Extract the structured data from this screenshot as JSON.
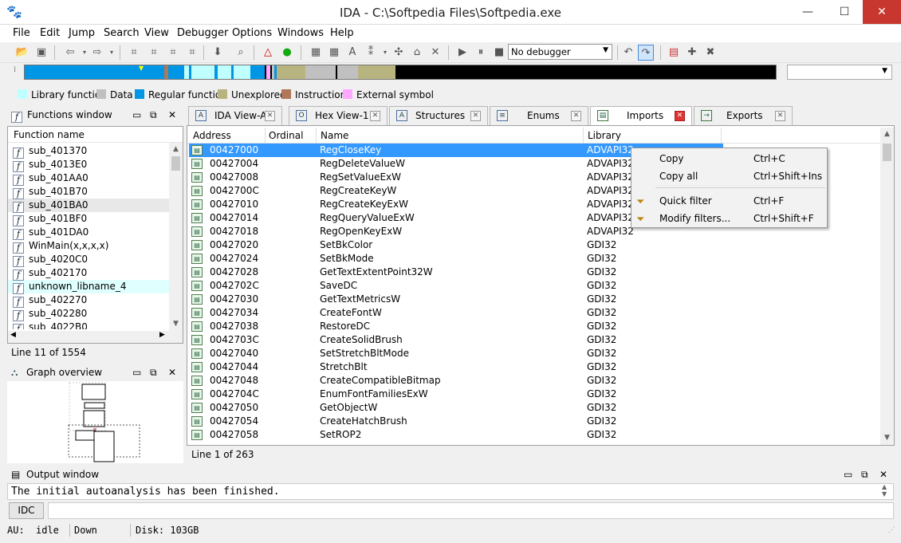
{
  "window": {
    "title": "IDA - C:\\Softpedia Files\\Softpedia.exe"
  },
  "menu": [
    "File",
    "Edit",
    "Jump",
    "Search",
    "View",
    "Debugger",
    "Options",
    "Windows",
    "Help"
  ],
  "toolbar": {
    "debugger_select": "No debugger"
  },
  "legend": [
    {
      "label": "Library function",
      "color": "#c0ffff"
    },
    {
      "label": "Data",
      "color": "#c0c0c0"
    },
    {
      "label": "Regular function",
      "color": "#0096e6"
    },
    {
      "label": "Unexplored",
      "color": "#b8b480"
    },
    {
      "label": "Instruction",
      "color": "#b07858"
    },
    {
      "label": "External symbol",
      "color": "#ffa8ff"
    }
  ],
  "functions_window": {
    "title": "Functions window",
    "column": "Function name",
    "items": [
      "sub_401370",
      "sub_4013E0",
      "sub_401AA0",
      "sub_401B70",
      "sub_401BA0",
      "sub_401BF0",
      "sub_401DA0",
      "WinMain(x,x,x,x)",
      "sub_4020C0",
      "sub_402170",
      "unknown_libname_4",
      "sub_402270",
      "sub_402280",
      "sub_4022B0"
    ],
    "status": "Line 11 of 1554"
  },
  "graph_overview": {
    "title": "Graph overview"
  },
  "tabs": [
    {
      "label": "IDA View-A",
      "icon": "A"
    },
    {
      "label": "Hex View-1",
      "icon": "O"
    },
    {
      "label": "Structures",
      "icon": "A"
    },
    {
      "label": "Enums",
      "icon": "≡"
    },
    {
      "label": "Imports",
      "icon": "▤"
    },
    {
      "label": "Exports",
      "icon": "→"
    }
  ],
  "imports": {
    "columns": [
      "Address",
      "Ordinal",
      "Name",
      "Library"
    ],
    "rows": [
      [
        "00427000",
        "RegCloseKey",
        "ADVAPI32"
      ],
      [
        "00427004",
        "RegDeleteValueW",
        "ADVAPI32"
      ],
      [
        "00427008",
        "RegSetValueExW",
        "ADVAPI32"
      ],
      [
        "0042700C",
        "RegCreateKeyW",
        "ADVAPI32"
      ],
      [
        "00427010",
        "RegCreateKeyExW",
        "ADVAPI32"
      ],
      [
        "00427014",
        "RegQueryValueExW",
        "ADVAPI32"
      ],
      [
        "00427018",
        "RegOpenKeyExW",
        "ADVAPI32"
      ],
      [
        "00427020",
        "SetBkColor",
        "GDI32"
      ],
      [
        "00427024",
        "SetBkMode",
        "GDI32"
      ],
      [
        "00427028",
        "GetTextExtentPoint32W",
        "GDI32"
      ],
      [
        "0042702C",
        "SaveDC",
        "GDI32"
      ],
      [
        "00427030",
        "GetTextMetricsW",
        "GDI32"
      ],
      [
        "00427034",
        "CreateFontW",
        "GDI32"
      ],
      [
        "00427038",
        "RestoreDC",
        "GDI32"
      ],
      [
        "0042703C",
        "CreateSolidBrush",
        "GDI32"
      ],
      [
        "00427040",
        "SetStretchBltMode",
        "GDI32"
      ],
      [
        "00427044",
        "StretchBlt",
        "GDI32"
      ],
      [
        "00427048",
        "CreateCompatibleBitmap",
        "GDI32"
      ],
      [
        "0042704C",
        "EnumFontFamiliesExW",
        "GDI32"
      ],
      [
        "00427050",
        "GetObjectW",
        "GDI32"
      ],
      [
        "00427054",
        "CreateHatchBrush",
        "GDI32"
      ],
      [
        "00427058",
        "SetROP2",
        "GDI32"
      ]
    ],
    "status": "Line 1 of 263"
  },
  "context_menu": [
    {
      "label": "Copy",
      "shortcut": "Ctrl+C"
    },
    {
      "label": "Copy all",
      "shortcut": "Ctrl+Shift+Ins"
    },
    {
      "label": "Quick filter",
      "shortcut": "Ctrl+F"
    },
    {
      "label": "Modify filters...",
      "shortcut": "Ctrl+Shift+F"
    }
  ],
  "output_window": {
    "title": "Output window",
    "text": "The initial autoanalysis has been finished.",
    "idc_button": "IDC"
  },
  "statusbar": {
    "au_label": "AU:",
    "au_value": "idle",
    "direction": "Down",
    "disk": "Disk: 103GB"
  }
}
